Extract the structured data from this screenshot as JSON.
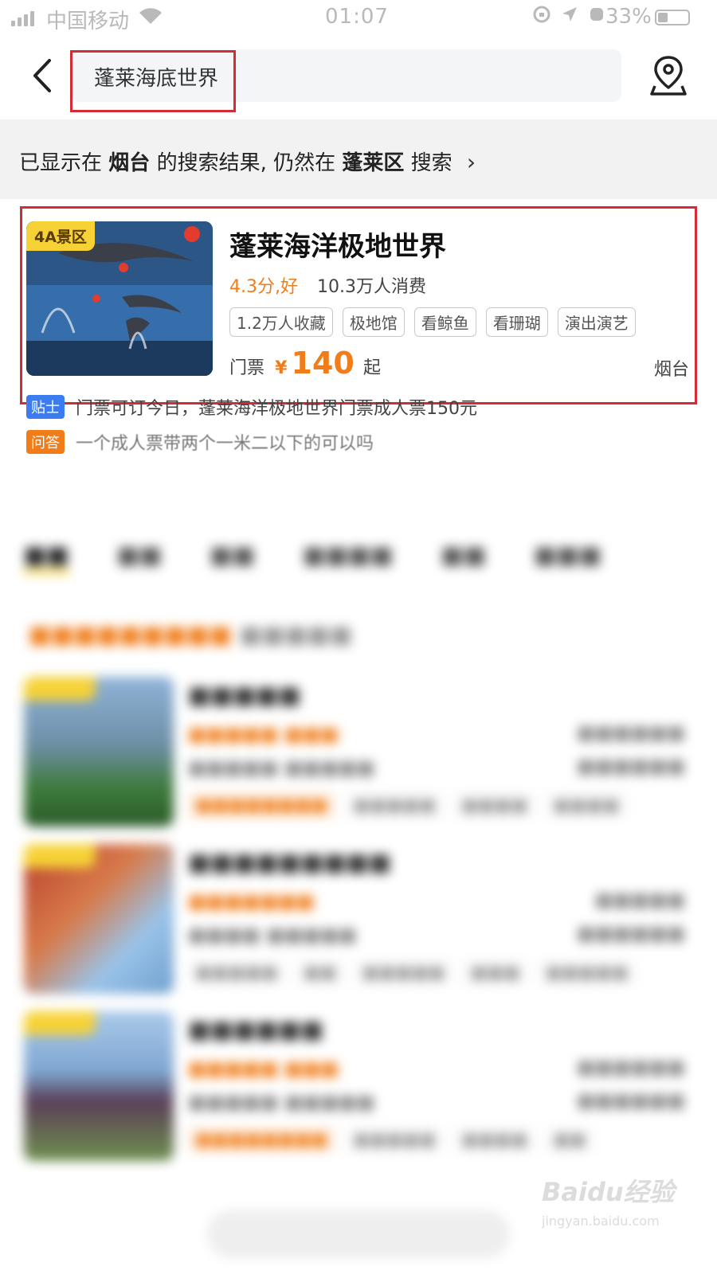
{
  "status_bar": {
    "carrier": "中国移动",
    "time": "01:07",
    "battery": "33%"
  },
  "header": {
    "search_query": "蓬莱海底世界",
    "back_icon": "chevron-left-icon",
    "location_icon": "map-pin-icon"
  },
  "notice": {
    "prefix": "已显示在",
    "city": "烟台",
    "middle": "的搜索结果, 仍然在",
    "district": "蓬莱区",
    "suffix": "搜索"
  },
  "result": {
    "badge": "4A景区",
    "title": "蓬莱海洋极地世界",
    "rating": "4.3分,好",
    "consumers": "10.3万人消费",
    "tags": [
      "1.2万人收藏",
      "极地馆",
      "看鲸鱼",
      "看珊瑚",
      "演出演艺"
    ],
    "price_label": "门票",
    "price_symbol": "¥",
    "price_value": "140",
    "price_suffix": "起",
    "city": "烟台",
    "tip": {
      "badge": "贴士",
      "text": "门票可订今日，蓬莱海洋极地世界门票成人票150元",
      "badge_color": "#3b7cf0"
    },
    "qa": {
      "badge": "问答",
      "text": "一个成人票带两个一米二以下的可以吗",
      "badge_color": "#f07d1a"
    }
  },
  "colors": {
    "accent_orange": "#f07d1a",
    "highlight_red": "#d42b36",
    "badge_yellow": "#f6d236"
  },
  "watermark": {
    "logo": "Baidu经验",
    "url": "jingyan.baidu.com"
  }
}
